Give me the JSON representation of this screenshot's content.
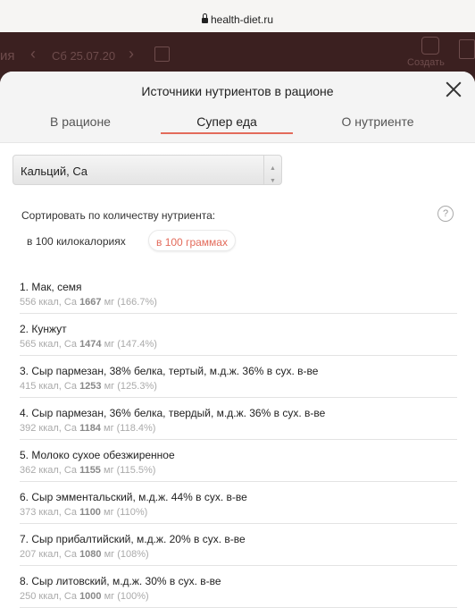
{
  "browser": {
    "url": "health-diet.ru"
  },
  "app_bar": {
    "title": "ия",
    "date": "Сб 25.07.20",
    "prev": "‹",
    "next": "›",
    "create_label": "Создать"
  },
  "modal": {
    "title": "Источники нутриентов в рационе",
    "tabs": [
      {
        "label": "В рационе",
        "active": false
      },
      {
        "label": "Супер еда",
        "active": true
      },
      {
        "label": "О нутриенте",
        "active": false
      }
    ],
    "nutrient_select": {
      "value": "Кальций, Ca",
      "arrow": "▲\n▼"
    },
    "sort": {
      "label": "Сортировать по количеству нутриента:",
      "options": [
        {
          "label": "в 100 килокалориях",
          "active": false
        },
        {
          "label": "в 100 граммах",
          "active": true
        }
      ],
      "help": "?"
    },
    "items": [
      {
        "name": "1. Мак, семя",
        "kcal": "556 ккал, Ca",
        "amount": "1667",
        "unit": "мг",
        "percent": "(166.7%)"
      },
      {
        "name": "2. Кунжут",
        "kcal": "565 ккал, Ca",
        "amount": "1474",
        "unit": "мг",
        "percent": "(147.4%)"
      },
      {
        "name": "3. Сыр пармезан, 38% белка, тертый, м.д.ж. 36% в сух. в-ве",
        "kcal": "415 ккал, Ca",
        "amount": "1253",
        "unit": "мг",
        "percent": "(125.3%)"
      },
      {
        "name": "4. Сыр пармезан, 36% белка, твердый, м.д.ж. 36% в сух. в-ве",
        "kcal": "392 ккал, Ca",
        "amount": "1184",
        "unit": "мг",
        "percent": "(118.4%)"
      },
      {
        "name": "5. Молоко сухое обезжиренное",
        "kcal": "362 ккал, Ca",
        "amount": "1155",
        "unit": "мг",
        "percent": "(115.5%)"
      },
      {
        "name": "6. Сыр эмментальский, м.д.ж. 44% в сух. в-ве",
        "kcal": "373 ккал, Ca",
        "amount": "1100",
        "unit": "мг",
        "percent": "(110%)"
      },
      {
        "name": "7. Сыр прибалтийский, м.д.ж. 20% в сух. в-ве",
        "kcal": "207 ккал, Ca",
        "amount": "1080",
        "unit": "мг",
        "percent": "(108%)"
      },
      {
        "name": "8. Сыр литовский, м.д.ж. 30% в сух. в-ве",
        "kcal": "250 ккал, Ca",
        "amount": "1000",
        "unit": "мг",
        "percent": "(100%)"
      }
    ]
  },
  "colors": {
    "accent": "#e36b5b",
    "backdrop": "#3b2020"
  },
  "icons": [
    "lock-icon",
    "calendar-icon",
    "create-icon",
    "close-icon",
    "help-icon",
    "dropdown-arrow-icon"
  ]
}
